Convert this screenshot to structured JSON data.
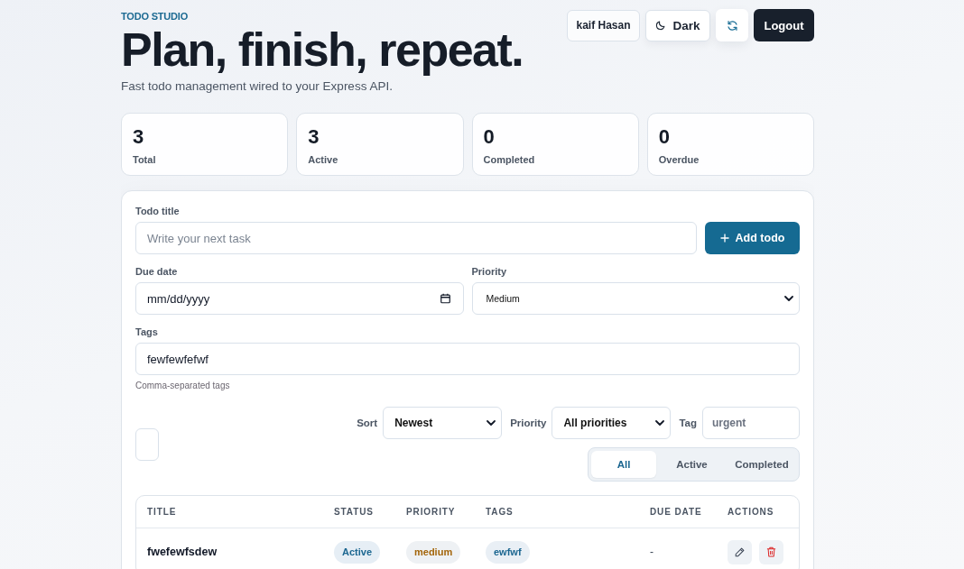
{
  "header": {
    "eyebrow": "TODO STUDIO",
    "title": "Plan, finish, repeat.",
    "subtitle": "Fast todo management wired to your Express API."
  },
  "actions": {
    "user": "kaif Hasan",
    "theme": "Dark",
    "logout": "Logout"
  },
  "stats": [
    {
      "value": "3",
      "label": "Total"
    },
    {
      "value": "3",
      "label": "Active"
    },
    {
      "value": "0",
      "label": "Completed"
    },
    {
      "value": "0",
      "label": "Overdue"
    }
  ],
  "form": {
    "title": {
      "label": "Todo title",
      "placeholder": "Write your next task"
    },
    "add_button": "Add todo",
    "due_date": {
      "label": "Due date",
      "placeholder": "mm/dd/yyyy"
    },
    "priority": {
      "label": "Priority",
      "value": "Medium"
    },
    "tags": {
      "label": "Tags",
      "value": "fewfewfefwf",
      "hint": "Comma-separated tags"
    }
  },
  "filters": {
    "sort": {
      "label": "Sort",
      "value": "Newest"
    },
    "priority": {
      "label": "Priority",
      "value": "All priorities"
    },
    "tag": {
      "label": "Tag",
      "placeholder": "urgent"
    },
    "tabs": [
      {
        "label": "All",
        "selected": true
      },
      {
        "label": "Active",
        "selected": false
      },
      {
        "label": "Completed",
        "selected": false
      }
    ]
  },
  "table": {
    "columns": [
      "TITLE",
      "STATUS",
      "PRIORITY",
      "TAGS",
      "DUE DATE",
      "ACTIONS"
    ],
    "rows": [
      {
        "title": "fwefewfsdew",
        "status": "Active",
        "priority": "medium",
        "tags": [
          "ewfwf"
        ],
        "due_date": "-"
      }
    ]
  }
}
